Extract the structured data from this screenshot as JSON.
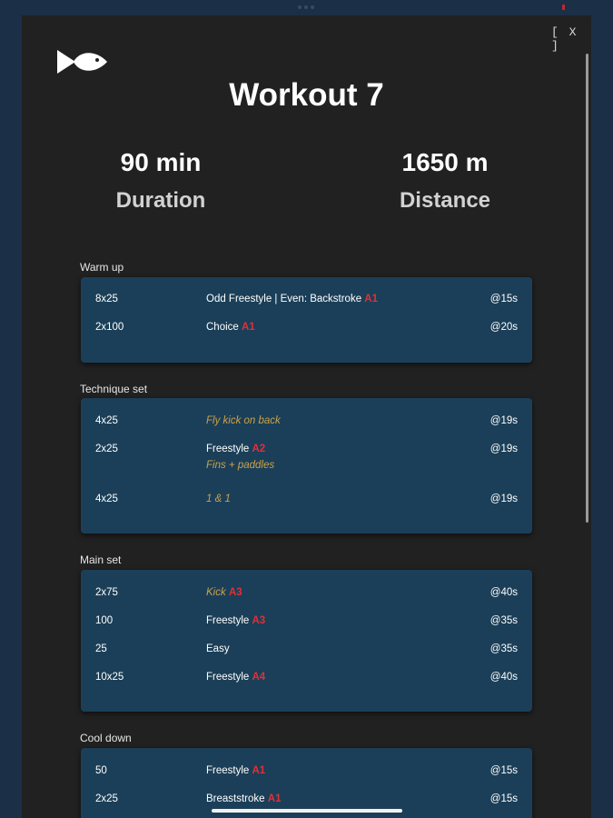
{
  "close_label": "[ X ]",
  "title": "Workout 7",
  "stats": {
    "duration": {
      "value": "90 min",
      "label": "Duration"
    },
    "distance": {
      "value": "1650 m",
      "label": "Distance"
    }
  },
  "sections": [
    {
      "title": "Warm up",
      "rows": [
        {
          "reps": "8x25",
          "desc": "Odd Freestyle | Even: Backstroke",
          "tag": "A1",
          "interval": "@15s"
        },
        {
          "reps": "2x100",
          "desc": "Choice",
          "tag": "A1",
          "interval": "@20s"
        }
      ]
    },
    {
      "title": "Technique set",
      "rows": [
        {
          "reps": "4x25",
          "desc": "Fly kick on back",
          "interval": "@19s"
        },
        {
          "reps": "2x25",
          "desc": "Freestyle",
          "tag": "A2",
          "sub": "Fins + paddles",
          "interval": "@19s"
        },
        {
          "reps": "4x25",
          "desc": "1 & 1",
          "interval": "@19s"
        }
      ]
    },
    {
      "title": "Main set",
      "rows": [
        {
          "reps": "2x75",
          "desc": "Kick",
          "tag": "A3",
          "interval": "@40s"
        },
        {
          "reps": "100",
          "desc": "Freestyle",
          "tag": "A3",
          "interval": "@35s"
        },
        {
          "reps": "25",
          "desc": "Easy",
          "interval": "@35s"
        },
        {
          "reps": "10x25",
          "desc": "Freestyle",
          "tag": "A4",
          "interval": "@40s"
        }
      ]
    },
    {
      "title": "Cool down",
      "rows": [
        {
          "reps": "50",
          "desc": "Freestyle",
          "tag": "A1",
          "interval": "@15s"
        },
        {
          "reps": "2x25",
          "desc": "Breaststroke",
          "tag": "A1",
          "interval": "@15s"
        }
      ]
    }
  ]
}
